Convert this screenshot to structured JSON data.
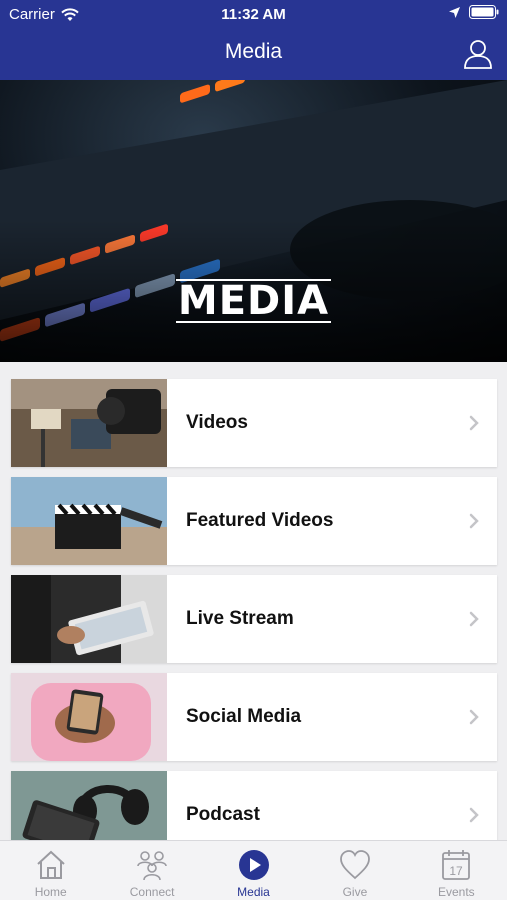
{
  "status": {
    "carrier": "Carrier",
    "time": "11:32 AM"
  },
  "nav": {
    "title": "Media"
  },
  "hero": {
    "title": "MEDIA"
  },
  "items": [
    {
      "label": "Videos",
      "icon": "camera-thumb"
    },
    {
      "label": "Featured Videos",
      "icon": "clapperboard-thumb"
    },
    {
      "label": "Live Stream",
      "icon": "tablet-thumb"
    },
    {
      "label": "Social Media",
      "icon": "phone-thumb"
    },
    {
      "label": "Podcast",
      "icon": "headphones-thumb"
    }
  ],
  "tabs": [
    {
      "label": "Home",
      "icon": "home-icon"
    },
    {
      "label": "Connect",
      "icon": "connect-icon"
    },
    {
      "label": "Media",
      "icon": "play-icon",
      "active": true
    },
    {
      "label": "Give",
      "icon": "heart-icon"
    },
    {
      "label": "Events",
      "icon": "calendar-icon"
    }
  ],
  "colors": {
    "accent": "#283593",
    "tab_inactive": "#9a9aa0",
    "background": "#efeff1"
  }
}
